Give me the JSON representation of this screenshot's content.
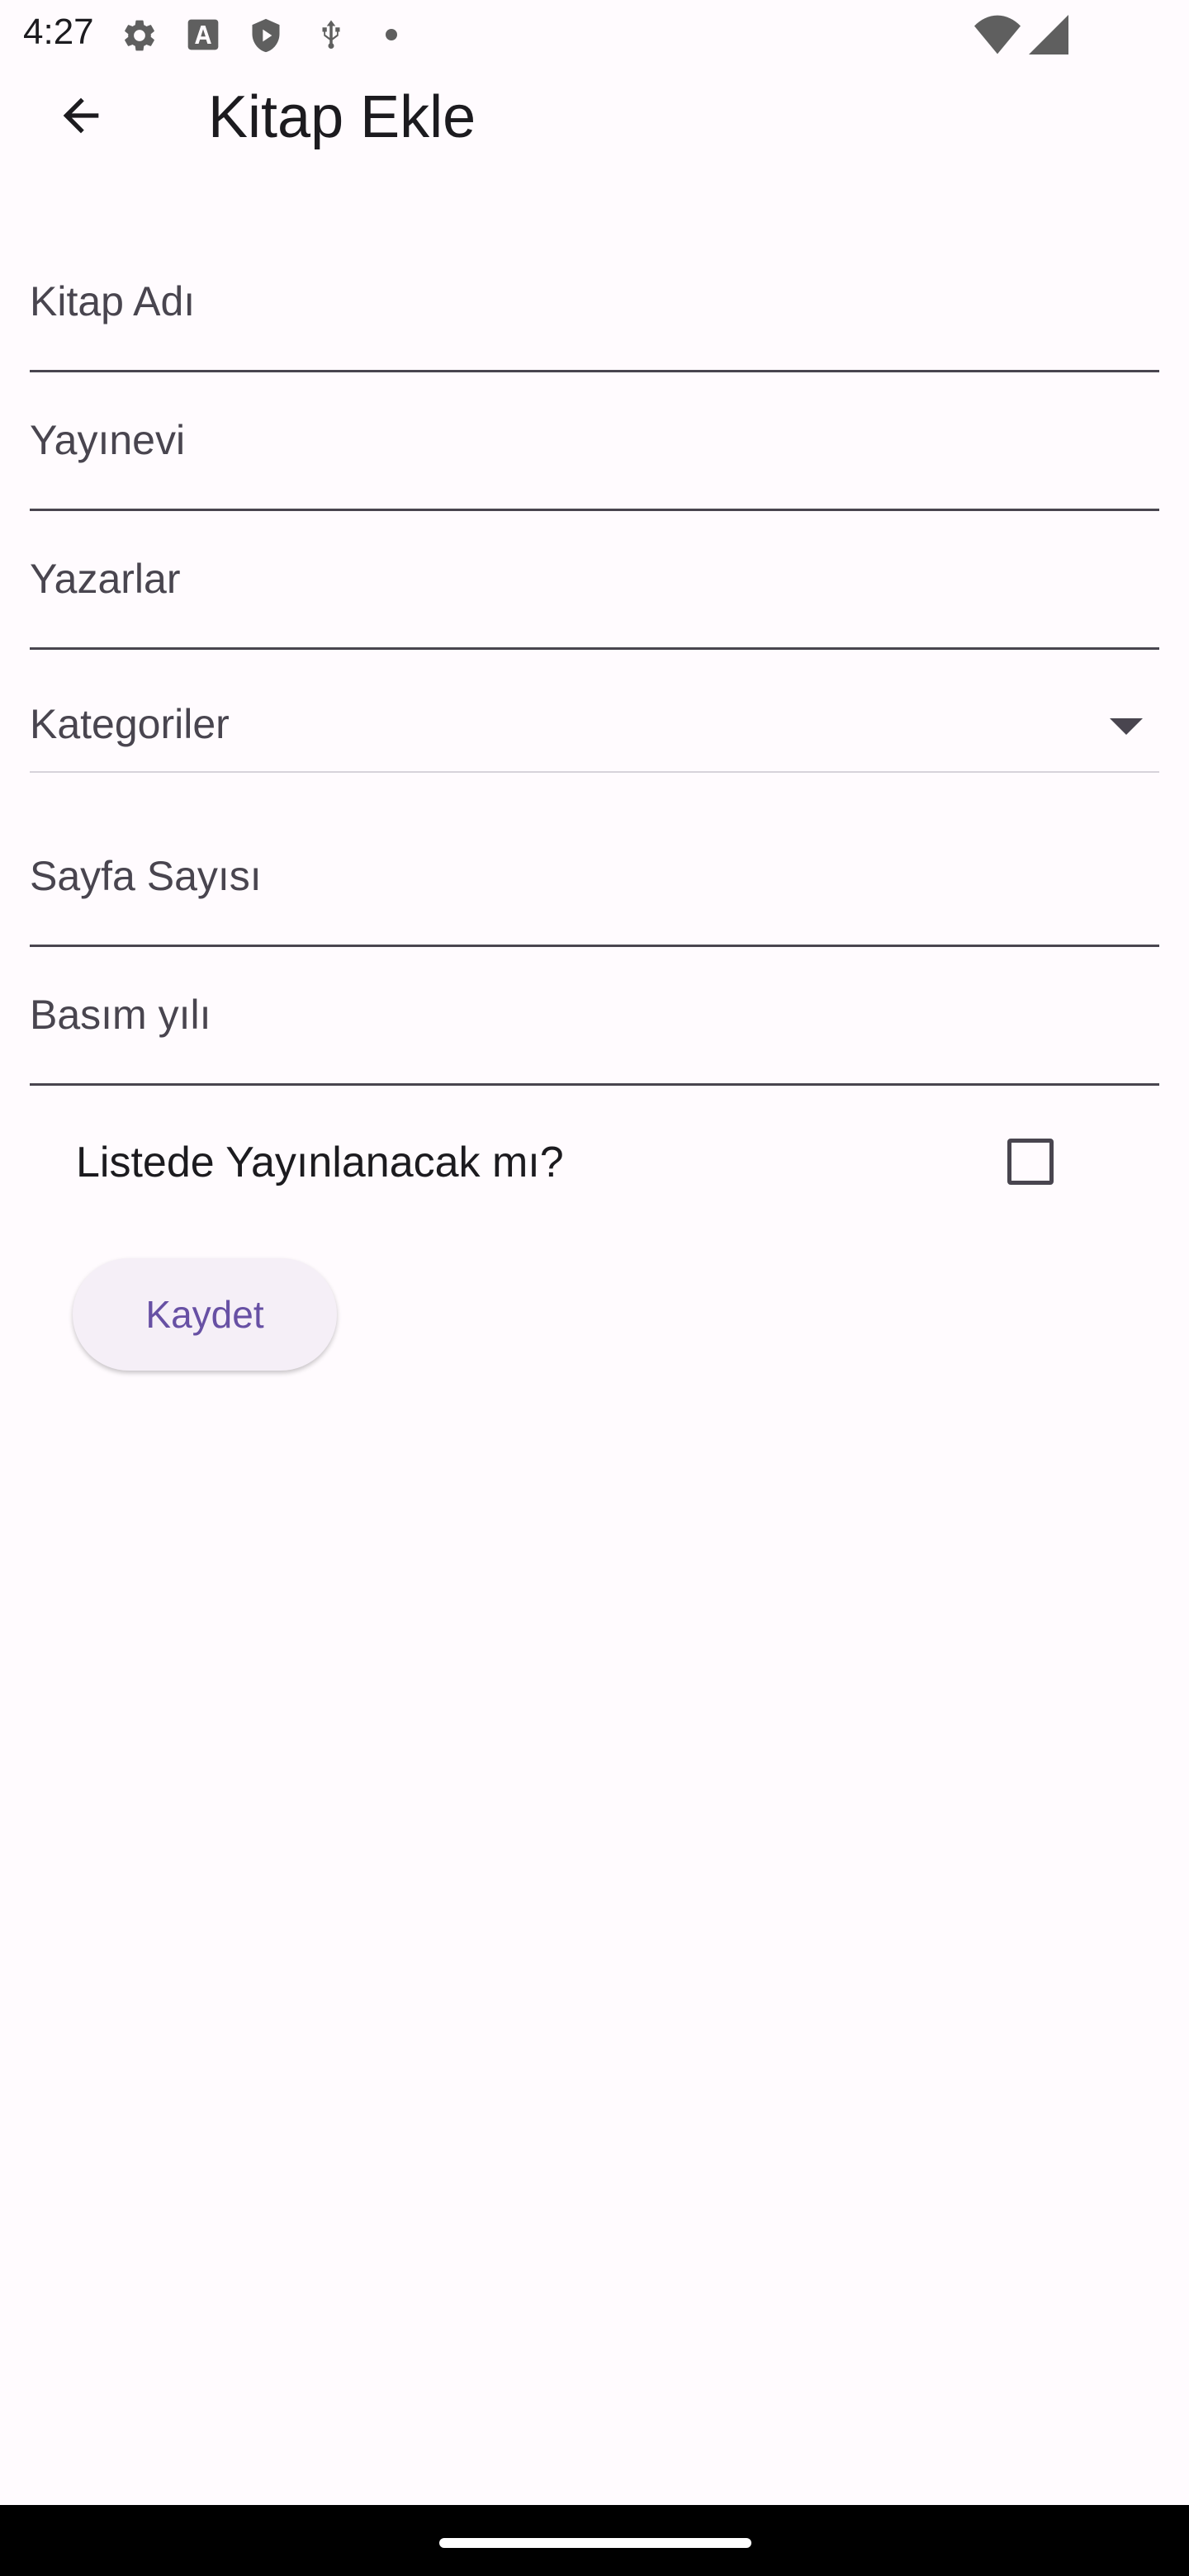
{
  "status_bar": {
    "time": "4:27",
    "icons": [
      "settings-icon",
      "font-a-icon",
      "shield-icon",
      "usb-icon",
      "dot-icon",
      "wifi-icon",
      "signal-icon"
    ]
  },
  "app_bar": {
    "title": "Kitap Ekle",
    "back_icon": "arrow-back-icon"
  },
  "form": {
    "book_name_label": "Kitap Adı",
    "publisher_label": "Yayınevi",
    "authors_label": "Yazarlar",
    "categories_label": "Kategoriler",
    "page_count_label": "Sayfa Sayısı",
    "print_year_label": "Basım yılı",
    "publish_in_list_label": "Listede Yayınlanacak mı?",
    "publish_in_list_checked": false,
    "save_label": "Kaydet"
  },
  "colors": {
    "background": "#fffbfe",
    "accent": "#6750a4",
    "button_surface": "#f5eff7",
    "label_text": "#49454f",
    "nav_bar": "#000000"
  }
}
